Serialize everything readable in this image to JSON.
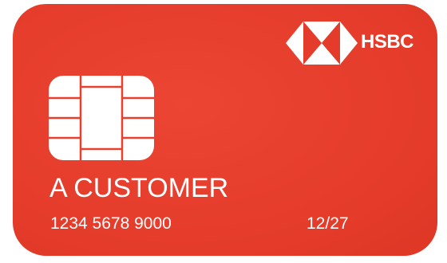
{
  "card": {
    "brand": "HSBC",
    "holder_name": "A CUSTOMER",
    "number": "1234 5678 9000",
    "expiry": "12/27",
    "colors": {
      "card_background": "#e8402e",
      "text": "#ffffff",
      "chip": "#ffffff"
    },
    "icons": {
      "logo": "hsbc-hexagon-logo-icon",
      "chip": "smart-card-chip-icon"
    }
  }
}
